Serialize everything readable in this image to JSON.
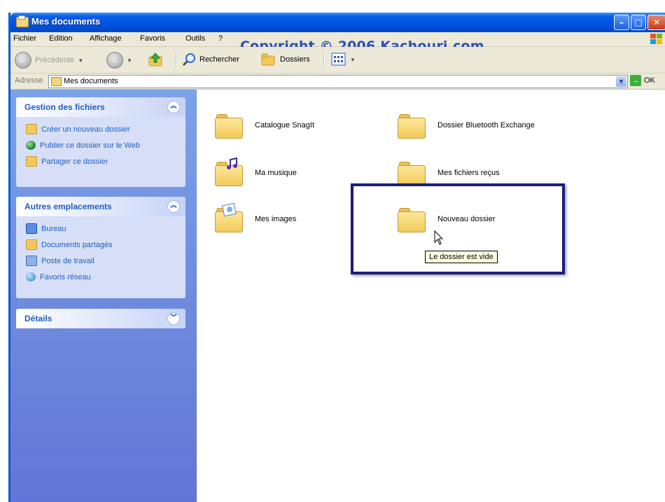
{
  "window": {
    "title": "Mes documents"
  },
  "titlebar_buttons": {
    "minimize": "–",
    "maximize": "□",
    "close": "✕"
  },
  "menubar": {
    "items": [
      "Fichier",
      "Edition",
      "Affichage",
      "Favoris",
      "Outils",
      "?"
    ]
  },
  "watermark": "Copyright © 2006 Kachouri.com",
  "toolbar": {
    "back_label": "Précédente",
    "search_label": "Rechercher",
    "folders_label": "Dossiers"
  },
  "address": {
    "label": "Adresse",
    "value": "Mes documents",
    "go_label": "OK"
  },
  "left_panels": [
    {
      "title": "Gestion des fichiers",
      "tasks": [
        "Créer un nouveau dossier",
        "Publier ce dossier sur le Web",
        "Partager ce dossier"
      ]
    },
    {
      "title": "Autres emplacements",
      "tasks": [
        "Bureau",
        "Documents partagés",
        "Poste de travail",
        "Favoris réseau"
      ]
    },
    {
      "title": "Détails",
      "tasks": []
    }
  ],
  "items": [
    {
      "label": "Catalogue SnagIt",
      "icon": "folder-icon"
    },
    {
      "label": "Ma musique",
      "icon": "music-folder-icon"
    },
    {
      "label": "Mes images",
      "icon": "pictures-folder-icon"
    },
    {
      "label": "Dossier Bluetooth Exchange",
      "icon": "folder-icon"
    },
    {
      "label": "Mes fichiers reçus",
      "icon": "folder-icon"
    },
    {
      "label": "Nouveau dossier",
      "icon": "folder-icon"
    }
  ],
  "tooltip": "Le dossier est vide",
  "colors": {
    "titlebar": "#0054e3",
    "taskpane": "#7ba2e7",
    "panel_title": "#215dc6",
    "highlight": "#1c1f78"
  }
}
